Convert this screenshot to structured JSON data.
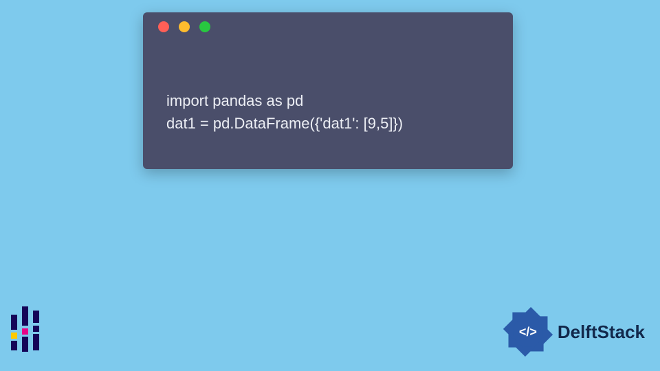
{
  "window": {
    "dots": {
      "red": "#ff5f57",
      "yellow": "#febc2e",
      "green": "#28c840"
    }
  },
  "code": {
    "line1": "import pandas as pd",
    "line2": "dat1 = pd.DataFrame({'dat1': [9,5]})"
  },
  "brand": {
    "name": "DelftStack",
    "badge_glyph": "</>"
  },
  "icons": {
    "pandas": "pandas-logo-icon",
    "delft": "delftstack-logo-icon"
  }
}
